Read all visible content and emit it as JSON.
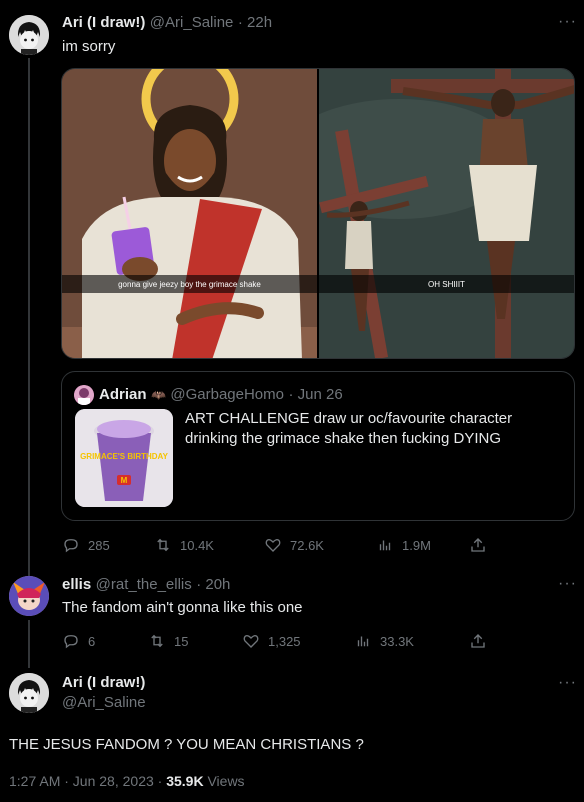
{
  "tweet1": {
    "name": "Ari (I draw!)",
    "handle": "@Ari_Saline",
    "time": "22h",
    "text": "im sorry",
    "more": "···",
    "media": {
      "left_caption": "gonna give jeezy boy the grimace shake",
      "right_caption": "OH SHIIIT"
    },
    "quote": {
      "name": "Adrian",
      "handle": "@GarbageHomo",
      "date": "Jun 26",
      "text": "ART CHALLENGE draw ur oc/favourite character drinking the grimace shake then fucking DYING",
      "cup_label": "GRIMACE'S BIRTHDAY"
    },
    "actions": {
      "replies": "285",
      "retweets": "10.4K",
      "likes": "72.6K",
      "views": "1.9M"
    }
  },
  "tweet2": {
    "name": "ellis",
    "handle": "@rat_the_ellis",
    "time": "20h",
    "text": "The fandom ain't gonna like this one",
    "more": "···",
    "actions": {
      "replies": "6",
      "retweets": "15",
      "likes": "1,325",
      "views": "33.3K"
    }
  },
  "tweet3": {
    "name": "Ari (I draw!)",
    "handle": "@Ari_Saline",
    "more": "···",
    "text": "THE JESUS FANDOM ? YOU MEAN CHRISTIANS ?",
    "timestamp": "1:27 AM · Jun 28, 2023 ·",
    "views_count": "35.9K",
    "views_label": "Views"
  },
  "colors": {
    "background": "#000000",
    "text": "#e7e9ea",
    "muted": "#71767b",
    "border": "#2f3336"
  }
}
